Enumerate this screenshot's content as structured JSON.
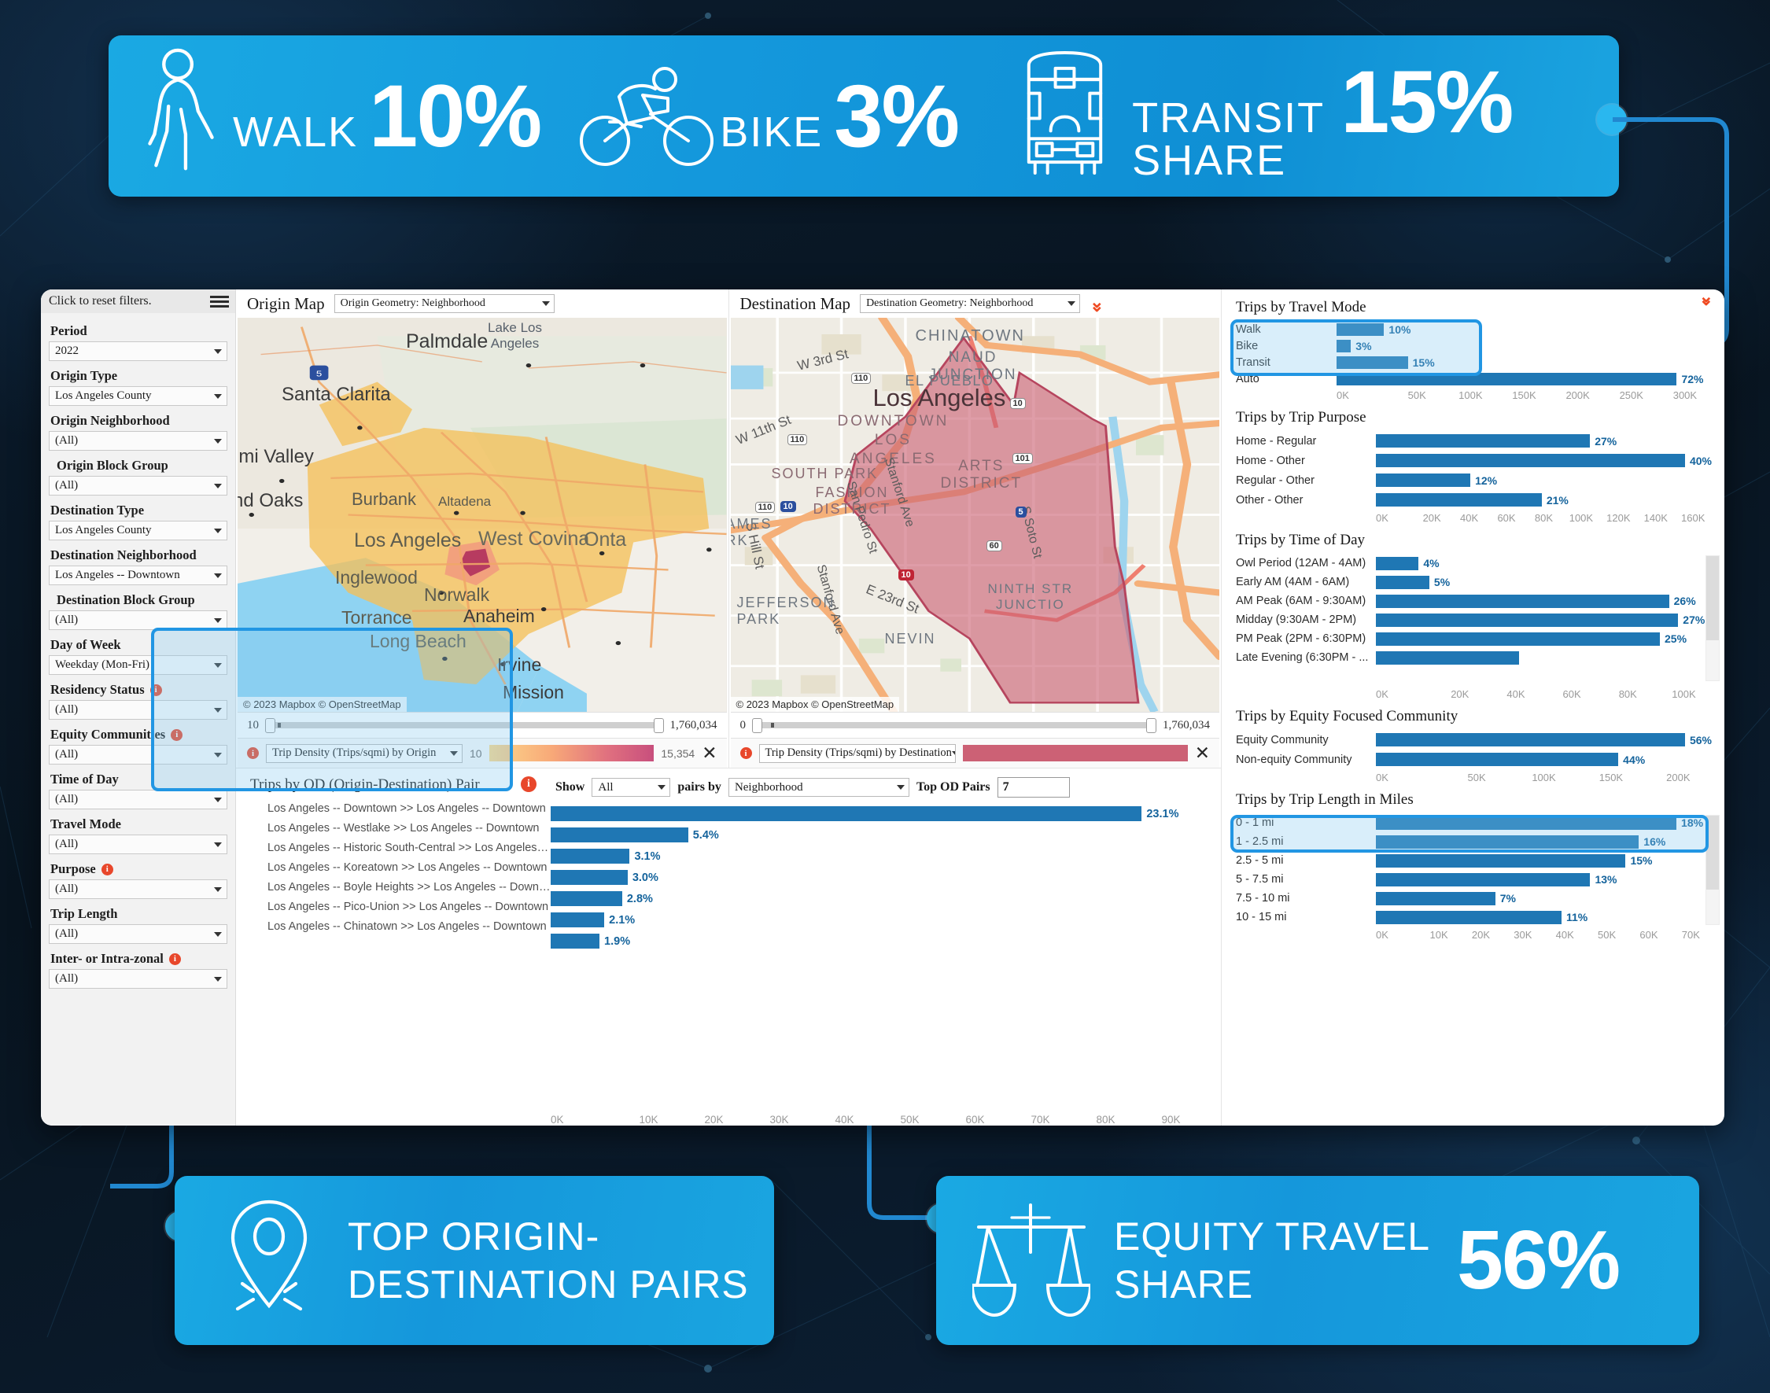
{
  "top_banner": {
    "kpis": [
      {
        "icon": "pedestrian-icon",
        "label": "WALK",
        "value": "10%"
      },
      {
        "icon": "bicycle-icon",
        "label": "BIKE",
        "value": "3%"
      },
      {
        "icon": "bus-icon",
        "label": "TRANSIT\nSHARE",
        "value": "15%"
      }
    ]
  },
  "sidebar": {
    "reset_text": "Click to reset filters.",
    "filters": [
      {
        "label": "Period",
        "value": "2022",
        "info": false,
        "indent": false
      },
      {
        "label": "Origin Type",
        "value": "Los Angeles County",
        "info": false,
        "indent": false
      },
      {
        "label": "Origin Neighborhood",
        "value": "(All)",
        "info": false,
        "indent": false
      },
      {
        "label": "Origin Block Group",
        "value": "(All)",
        "info": false,
        "indent": true
      },
      {
        "label": "Destination Type",
        "value": "Los Angeles County",
        "info": false,
        "indent": false
      },
      {
        "label": "Destination Neighborhood",
        "value": "Los Angeles -- Downtown",
        "info": false,
        "indent": false
      },
      {
        "label": "Destination Block Group",
        "value": "(All)",
        "info": false,
        "indent": true
      },
      {
        "label": "Day of Week",
        "value": "Weekday (Mon-Fri)",
        "info": false,
        "indent": false
      },
      {
        "label": "Residency Status",
        "value": "(All)",
        "info": true,
        "indent": false
      },
      {
        "label": "Equity Communities",
        "value": "(All)",
        "info": true,
        "indent": false
      },
      {
        "label": "Time of Day",
        "value": "(All)",
        "info": false,
        "indent": false
      },
      {
        "label": "Travel Mode",
        "value": "(All)",
        "info": false,
        "indent": false
      },
      {
        "label": "Purpose",
        "value": "(All)",
        "info": true,
        "indent": false
      },
      {
        "label": "Trip Length",
        "value": "(All)",
        "info": false,
        "indent": false
      },
      {
        "label": "Inter- or Intra-zonal",
        "value": "(All)",
        "info": true,
        "indent": false
      }
    ]
  },
  "origin_map": {
    "title": "Origin Map",
    "geometry_select": "Origin Geometry: Neighborhood",
    "attribution": "© 2023 Mapbox  © OpenStreetMap",
    "slider_min": "10",
    "slider_max": "1,760,034",
    "legend_select": "Trip Density (Trips/sqmi) by Origin",
    "legend_min": "10",
    "legend_max": "15,354",
    "labels": [
      "Palmdale",
      "Lake Los Angeles",
      "Santa Clarita",
      "imi Valley",
      "nd Oaks",
      "Burbank",
      "Altadena",
      "Los Angeles",
      "West Covina",
      "Onta",
      "Inglewood",
      "Norwalk",
      "Torrance",
      "Anaheim",
      "Long Beach",
      "Irvine",
      "Mission"
    ]
  },
  "destination_map": {
    "title": "Destination Map",
    "geometry_select": "Destination Geometry: Neighborhood",
    "attribution": "© 2023 Mapbox  © OpenStreetMap",
    "slider_min": "0",
    "slider_max": "1,760,034",
    "legend_select": "Trip Density (Trips/sqmi) by Destination",
    "labels": [
      "CHINATOWN",
      "NAUD JUNCTION",
      "EL PUEBLO",
      "Los Angeles",
      "DOWNTOWN LOS ANGELES",
      "ARTS DISTRICT",
      "SOUTH PARK",
      "FASHION DISTRICT",
      "San Pedro St",
      "Stanford Ave",
      "W 3rd St",
      "W 11th St",
      "S Hill St",
      "JEFFERSON PARK",
      "AMES RK",
      "E 23rd St",
      "NEVIN",
      "NINTH STR JUNCTIO",
      "S Soto St"
    ],
    "shields": [
      "110",
      "110",
      "110",
      "10",
      "10",
      "10",
      "101",
      "5",
      "60"
    ]
  },
  "od_panel": {
    "title": "Trips by OD (Origin-Destination) Pair",
    "show_label": "Show",
    "show_value": "All",
    "pairs_by_label": "pairs by",
    "pairs_by_value": "Neighborhood",
    "top_pairs_label": "Top OD Pairs",
    "top_pairs_value": "7"
  },
  "chart_data": [
    {
      "id": "od_pairs",
      "type": "bar",
      "title": "Trips by OD (Origin-Destination) Pair",
      "orientation": "horizontal",
      "categories": [
        "Los Angeles -- Downtown >> Los Angeles -- Downtown",
        "Los Angeles -- Westlake >> Los Angeles -- Downtown",
        "Los Angeles -- Historic South-Central >> Los Angeles -- Downto..",
        "Los Angeles -- Koreatown >> Los Angeles -- Downtown",
        "Los Angeles -- Boyle Heights >> Los Angeles -- Downtown",
        "Los Angeles -- Pico-Union >> Los Angeles -- Downtown",
        "Los Angeles -- Chinatown >> Los Angeles -- Downtown"
      ],
      "values": [
        86000,
        20000,
        11500,
        11200,
        10400,
        7800,
        7100
      ],
      "labels": [
        "23.1%",
        "5.4%",
        "3.1%",
        "3.0%",
        "2.8%",
        "2.1%",
        "1.9%"
      ],
      "xticks": [
        "0K",
        "10K",
        "20K",
        "30K",
        "40K",
        "50K",
        "60K",
        "70K",
        "80K",
        "90K"
      ],
      "xlim": [
        0,
        95000
      ],
      "xlabel": "",
      "ylabel": "",
      "grid": false
    },
    {
      "id": "travel_mode",
      "type": "bar",
      "title": "Trips by Travel Mode",
      "orientation": "horizontal",
      "categories": [
        "Walk",
        "Bike",
        "Transit"
      ],
      "values": [
        38000,
        11500,
        57000
      ],
      "labels": [
        "10%",
        "3%",
        "15%"
      ],
      "extra_categories": [
        "Auto"
      ],
      "extra_values": [
        272000
      ],
      "extra_labels": [
        "72%"
      ],
      "xticks": [
        "0K",
        "50K",
        "100K",
        "150K",
        "200K",
        "250K",
        "300K"
      ],
      "xlim": [
        0,
        300000
      ],
      "highlight": [
        "Walk",
        "Bike",
        "Transit"
      ]
    },
    {
      "id": "trip_purpose",
      "type": "bar",
      "title": "Trips by Trip Purpose",
      "orientation": "horizontal",
      "categories": [
        "Home -  Regular",
        "Home - Other",
        "Regular - Other",
        "Other - Other"
      ],
      "values": [
        102000,
        150000,
        45000,
        79000
      ],
      "labels": [
        "27%",
        "40%",
        "12%",
        "21%"
      ],
      "xticks": [
        "0K",
        "20K",
        "40K",
        "60K",
        "80K",
        "100K",
        "120K",
        "140K",
        "160K"
      ],
      "xlim": [
        0,
        160000
      ]
    },
    {
      "id": "time_of_day",
      "type": "bar",
      "title": "Trips by Time of Day",
      "orientation": "horizontal",
      "categories": [
        "Owl Period (12AM - 4AM)",
        "Early AM (4AM - 6AM)",
        "AM Peak (6AM - 9:30AM)",
        "Midday (9:30AM - 2PM)",
        "PM Peak (2PM - 6:30PM)",
        "Late Evening (6:30PM - ..."
      ],
      "values": [
        14000,
        17500,
        96000,
        99000,
        93000,
        47000
      ],
      "labels": [
        "4%",
        "5%",
        "26%",
        "27%",
        "25%",
        ""
      ],
      "xticks": [
        "0K",
        "20K",
        "40K",
        "60K",
        "80K",
        "100K"
      ],
      "xlim": [
        0,
        110000
      ],
      "scrollable": true
    },
    {
      "id": "equity_community",
      "type": "bar",
      "title": "Trips by Equity Focused Community",
      "orientation": "horizontal",
      "categories": [
        "Equity Community",
        "Non-equity Community"
      ],
      "values": [
        212000,
        166000
      ],
      "labels": [
        "56%",
        "44%"
      ],
      "xticks": [
        "0K",
        "50K",
        "100K",
        "150K",
        "200K"
      ],
      "xlim": [
        0,
        230000
      ],
      "highlight": [
        "Equity Community",
        "Non-equity Community"
      ]
    },
    {
      "id": "trip_length",
      "type": "bar",
      "title": "Trips by Trip Length in Miles",
      "orientation": "horizontal",
      "categories": [
        "0 - 1 mi",
        "1 - 2.5 mi",
        "2.5 - 5 mi",
        "5 - 7.5 mi",
        "7.5 - 10 mi",
        "10 - 15 mi"
      ],
      "values": [
        68000,
        59500,
        56500,
        48500,
        27000,
        42000
      ],
      "labels": [
        "18%",
        "16%",
        "15%",
        "13%",
        "7%",
        "11%"
      ],
      "xticks": [
        "0K",
        "10K",
        "20K",
        "30K",
        "40K",
        "50K",
        "60K",
        "70K"
      ],
      "xlim": [
        0,
        76000
      ],
      "scrollable": true
    }
  ],
  "callouts": [
    {
      "icon": "map-pin-icon",
      "text": "TOP ORIGIN-\nDESTINATION PAIRS",
      "value": ""
    },
    {
      "icon": "scales-icon",
      "text": "EQUITY TRAVEL\nSHARE",
      "value": "56%"
    }
  ],
  "colors": {
    "accent_blue": "#1aa9e3",
    "bar_blue": "#1f77b4",
    "highlight_border": "#2196e3",
    "info_red": "#e8472b",
    "chevron_orange": "#ef4a22",
    "destination_fill": "#cc6175"
  }
}
